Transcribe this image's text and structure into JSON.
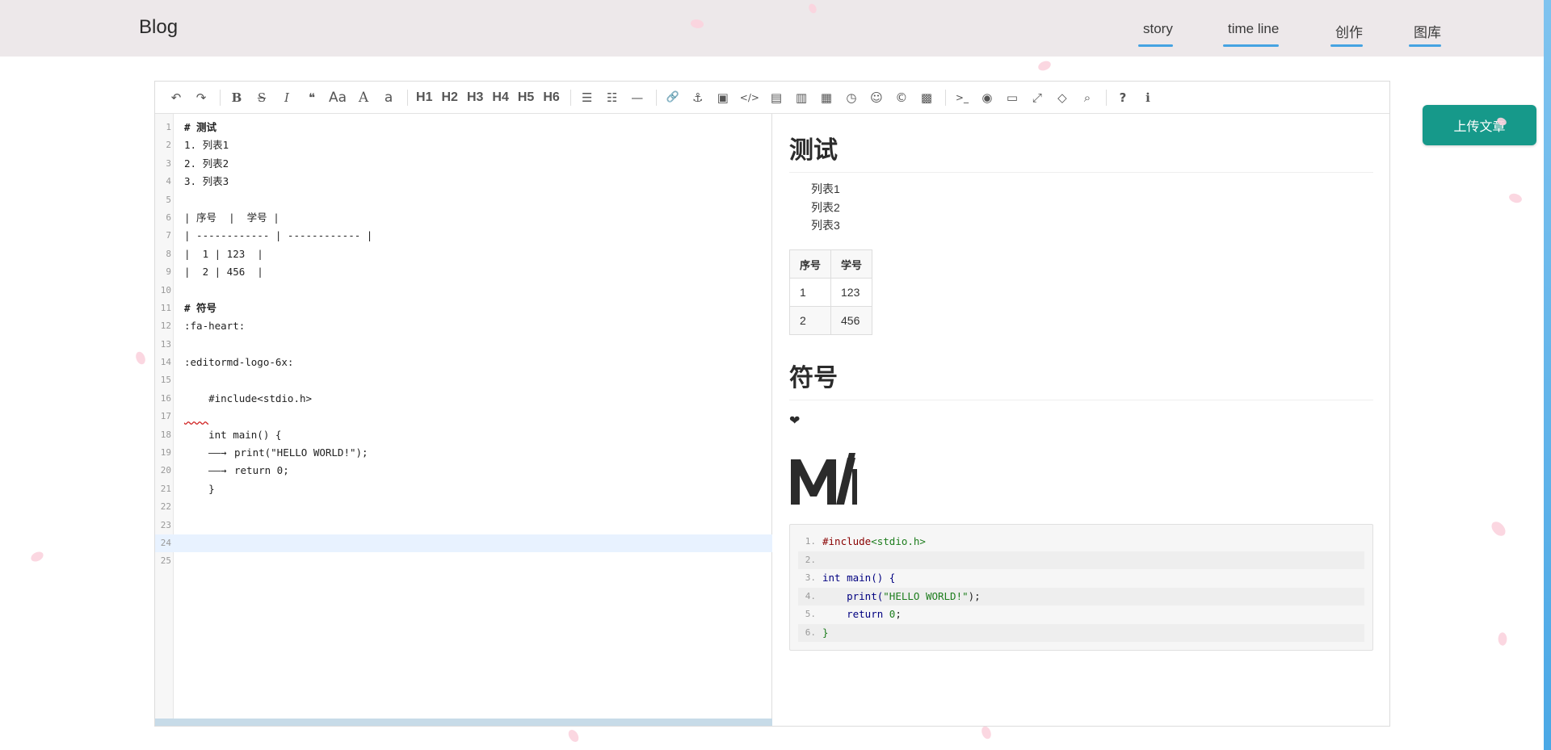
{
  "header": {
    "brand": "Blog",
    "nav": [
      {
        "icon": "",
        "label": "story"
      },
      {
        "icon": "",
        "label": "time line"
      },
      {
        "icon": "",
        "label": "创作"
      },
      {
        "icon": "",
        "label": "图库"
      }
    ]
  },
  "upload_button": "上传文章",
  "toolbar": {
    "undo": "↶",
    "redo": "↷",
    "bold": "B",
    "strike": "S",
    "italic": "I",
    "quote": "❝",
    "uppercase": "Aa",
    "ucwords": "A",
    "lowercase": "a",
    "h1": "H1",
    "h2": "H2",
    "h3": "H3",
    "h4": "H4",
    "h5": "H5",
    "h6": "H6",
    "list_ul": "☰",
    "list_ol": "☷",
    "hr": "—",
    "link": "🔗",
    "anchor": "⚓",
    "image": "▣",
    "code": "</>",
    "preformatted": "▤",
    "code_block": "▥",
    "table": "▦",
    "datetime": "◷",
    "emoji": "☺",
    "entities": "©",
    "pagebreak": "▩",
    "goto_line": ">_",
    "watch": "◉",
    "preview": "▭",
    "fullscreen": "⤢",
    "clear": "◇",
    "search": "⌕",
    "help": "?",
    "info": "ℹ"
  },
  "editor": {
    "lines": [
      {
        "n": "1",
        "text": "# 测试"
      },
      {
        "n": "2",
        "text": "1. 列表1"
      },
      {
        "n": "3",
        "text": "2. 列表2"
      },
      {
        "n": "4",
        "text": "3. 列表3"
      },
      {
        "n": "5",
        "text": ""
      },
      {
        "n": "6",
        "text": "| 序号  |  学号 |"
      },
      {
        "n": "7",
        "text": "| ------------ | ------------ |"
      },
      {
        "n": "8",
        "text": "|  1 | 123  |"
      },
      {
        "n": "9",
        "text": "|  2 | 456  |"
      },
      {
        "n": "10",
        "text": ""
      },
      {
        "n": "11",
        "text": "# 符号"
      },
      {
        "n": "12",
        "text": ":fa-heart:"
      },
      {
        "n": "13",
        "text": ""
      },
      {
        "n": "14",
        "text": ":editormd-logo-6x:"
      },
      {
        "n": "15",
        "text": ""
      },
      {
        "n": "16",
        "text": "    #include<stdio.h>"
      },
      {
        "n": "17",
        "text": ""
      },
      {
        "n": "18",
        "text": "    int main() {"
      },
      {
        "n": "19",
        "text": "print(\"HELLO WORLD!\");"
      },
      {
        "n": "20",
        "text": "return 0;"
      },
      {
        "n": "21",
        "text": "    }"
      },
      {
        "n": "22",
        "text": ""
      },
      {
        "n": "23",
        "text": ""
      },
      {
        "n": "24",
        "text": ""
      },
      {
        "n": "25",
        "text": ""
      }
    ]
  },
  "preview": {
    "h1_a": "测试",
    "list": [
      "列表1",
      "列表2",
      "列表3"
    ],
    "table": {
      "headers": [
        "序号",
        "学号"
      ],
      "rows": [
        [
          "1",
          "123"
        ],
        [
          "2",
          "456"
        ]
      ]
    },
    "h1_b": "符号",
    "heart": "❤",
    "code": [
      {
        "n": "1.",
        "a": "#include",
        "b": "<stdio.h>"
      },
      {
        "n": "2.",
        "a": "",
        "b": ""
      },
      {
        "n": "3.",
        "a": "int main() {",
        "b": ""
      },
      {
        "n": "4.",
        "a": "    print(",
        "b": "\"HELLO WORLD!\"",
        "c": ");"
      },
      {
        "n": "5.",
        "a": "    return ",
        "b": "0",
        "c": ";"
      },
      {
        "n": "6.",
        "a": "}",
        "b": ""
      }
    ]
  }
}
